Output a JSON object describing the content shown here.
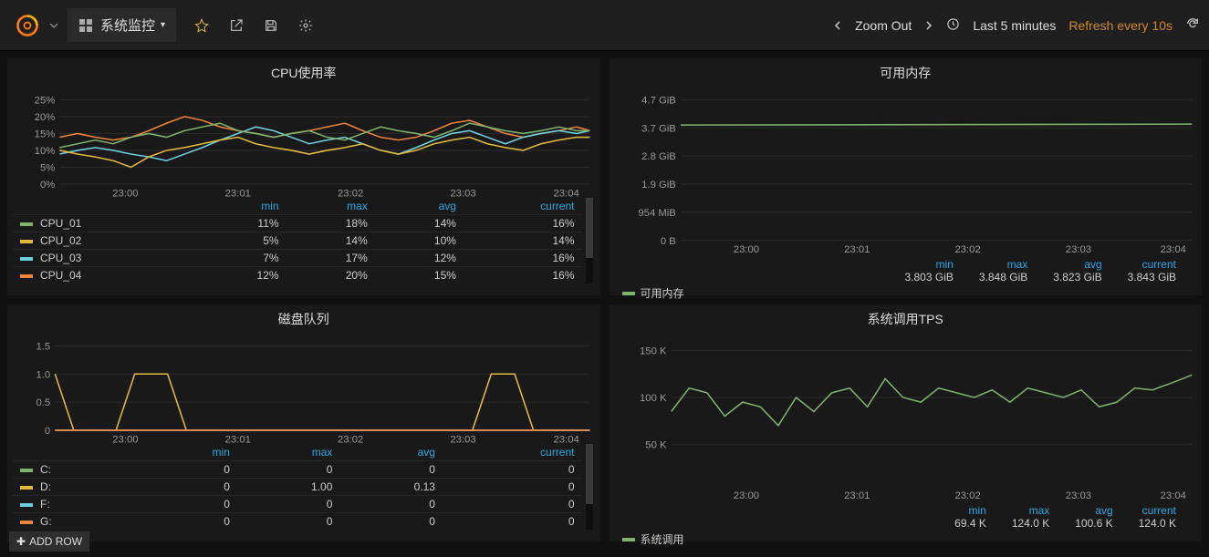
{
  "header": {
    "dashboard_title": "系统监控",
    "zoom_label": "Zoom Out",
    "time_range": "Last 5 minutes",
    "refresh_label": "Refresh every 10s"
  },
  "footer": {
    "add_row": "ADD ROW"
  },
  "legend_headers": {
    "min": "min",
    "max": "max",
    "avg": "avg",
    "current": "current"
  },
  "time_axis": [
    "23:00",
    "23:01",
    "23:02",
    "23:03",
    "23:04"
  ],
  "panels": {
    "cpu": {
      "title": "CPU使用率",
      "y_ticks": [
        "25%",
        "20%",
        "15%",
        "10%",
        "5%",
        "0%"
      ],
      "legend": [
        {
          "name": "CPU_01",
          "color": "#7eb26d",
          "min": "11%",
          "max": "18%",
          "avg": "14%",
          "cur": "16%"
        },
        {
          "name": "CPU_02",
          "color": "#e4b93c",
          "min": "5%",
          "max": "14%",
          "avg": "10%",
          "cur": "14%"
        },
        {
          "name": "CPU_03",
          "color": "#6ed0e0",
          "min": "7%",
          "max": "17%",
          "avg": "12%",
          "cur": "16%"
        },
        {
          "name": "CPU_04",
          "color": "#ef843c",
          "min": "12%",
          "max": "20%",
          "avg": "15%",
          "cur": "16%"
        }
      ]
    },
    "mem": {
      "title": "可用内存",
      "y_ticks": [
        "4.7 GiB",
        "3.7 GiB",
        "2.8 GiB",
        "1.9 GiB",
        "954 MiB",
        "0 B"
      ],
      "series": {
        "name": "可用内存",
        "color": "#7eb26d",
        "min": "3.803 GiB",
        "max": "3.848 GiB",
        "avg": "3.823 GiB",
        "cur": "3.843 GiB"
      }
    },
    "disk": {
      "title": "磁盘队列",
      "y_ticks": [
        "1.5",
        "1.0",
        "0.5",
        "0"
      ],
      "legend": [
        {
          "name": "C:",
          "color": "#7eb26d",
          "min": "0",
          "max": "0",
          "avg": "0",
          "cur": "0"
        },
        {
          "name": "D:",
          "color": "#e4b93c",
          "min": "0",
          "max": "1.00",
          "avg": "0.13",
          "cur": "0"
        },
        {
          "name": "F:",
          "color": "#6ed0e0",
          "min": "0",
          "max": "0",
          "avg": "0",
          "cur": "0"
        },
        {
          "name": "G:",
          "color": "#ef843c",
          "min": "0",
          "max": "0",
          "avg": "0",
          "cur": "0"
        }
      ]
    },
    "tps": {
      "title": "系统调用TPS",
      "y_ticks": [
        "150 K",
        "100 K",
        "50 K"
      ],
      "series": {
        "name": "系统调用",
        "color": "#7eb26d",
        "min": "69.4 K",
        "max": "124.0 K",
        "avg": "100.6 K",
        "cur": "124.0 K"
      }
    }
  },
  "chart_data": [
    {
      "panel": "cpu",
      "type": "line",
      "x_ticks": [
        "23:00",
        "23:01",
        "23:02",
        "23:03",
        "23:04"
      ],
      "ylim": [
        0,
        25
      ],
      "y_unit": "%",
      "series": [
        {
          "name": "CPU_01",
          "values": [
            11,
            12,
            13,
            12,
            14,
            15,
            14,
            16,
            17,
            18,
            16,
            15,
            14,
            15,
            16,
            14,
            13,
            15,
            17,
            16,
            15,
            14,
            16,
            18,
            17,
            16,
            15,
            16,
            17,
            16,
            16
          ]
        },
        {
          "name": "CPU_02",
          "values": [
            10,
            9,
            8,
            7,
            5,
            8,
            10,
            11,
            12,
            13,
            14,
            12,
            11,
            10,
            9,
            10,
            11,
            12,
            10,
            9,
            10,
            12,
            13,
            14,
            12,
            11,
            10,
            12,
            13,
            14,
            14
          ]
        },
        {
          "name": "CPU_03",
          "values": [
            9,
            10,
            11,
            10,
            9,
            8,
            7,
            9,
            11,
            13,
            15,
            17,
            16,
            14,
            12,
            13,
            14,
            12,
            10,
            9,
            11,
            13,
            15,
            16,
            14,
            12,
            14,
            15,
            16,
            15,
            16
          ]
        },
        {
          "name": "CPU_04",
          "values": [
            14,
            15,
            14,
            13,
            14,
            16,
            18,
            20,
            19,
            17,
            16,
            15,
            14,
            15,
            16,
            17,
            18,
            16,
            14,
            13,
            14,
            16,
            18,
            19,
            17,
            15,
            14,
            15,
            16,
            17,
            16
          ]
        }
      ]
    },
    {
      "panel": "mem",
      "type": "line",
      "x_ticks": [
        "23:00",
        "23:01",
        "23:02",
        "23:03",
        "23:04"
      ],
      "ylim": [
        0,
        4.7
      ],
      "y_unit": "GiB",
      "series": [
        {
          "name": "可用内存",
          "values": [
            3.82,
            3.81,
            3.8,
            3.81,
            3.82,
            3.83,
            3.82,
            3.83,
            3.84,
            3.85,
            3.84,
            3.83,
            3.82,
            3.82,
            3.83,
            3.83,
            3.82,
            3.82,
            3.83,
            3.84,
            3.83,
            3.82,
            3.83,
            3.84,
            3.85,
            3.84,
            3.83,
            3.84,
            3.84,
            3.84,
            3.84
          ]
        }
      ]
    },
    {
      "panel": "disk",
      "type": "line",
      "x_ticks": [
        "23:00",
        "23:01",
        "23:02",
        "23:03",
        "23:04"
      ],
      "ylim": [
        0,
        1.5
      ],
      "series": [
        {
          "name": "C:",
          "values": [
            0,
            0,
            0,
            0,
            0,
            0,
            0,
            0,
            0,
            0,
            0,
            0,
            0,
            0,
            0,
            0,
            0,
            0,
            0,
            0,
            0,
            0,
            0,
            0,
            0,
            0,
            0,
            0,
            0,
            0,
            0
          ]
        },
        {
          "name": "D:",
          "values": [
            1,
            0,
            0,
            0,
            0,
            1,
            1,
            1,
            0,
            0,
            0,
            0,
            0,
            0,
            0,
            0,
            0,
            0,
            0,
            0,
            0,
            0,
            0,
            0,
            1,
            1,
            0,
            0,
            0,
            0,
            0
          ]
        },
        {
          "name": "F:",
          "values": [
            0,
            0,
            0,
            0,
            0,
            0,
            0,
            0,
            0,
            0,
            0,
            0,
            0,
            0,
            0,
            0,
            0,
            0,
            0,
            0,
            0,
            0,
            0,
            0,
            0,
            0,
            0,
            0,
            0,
            0,
            0
          ]
        },
        {
          "name": "G:",
          "values": [
            0,
            0,
            0,
            0,
            0,
            0,
            0,
            0,
            0,
            0,
            0,
            0,
            0,
            0,
            0,
            0,
            0,
            0,
            0,
            0,
            0,
            0,
            0,
            0,
            0,
            0,
            0,
            0,
            0,
            0,
            0
          ]
        }
      ]
    },
    {
      "panel": "tps",
      "type": "line",
      "x_ticks": [
        "23:00",
        "23:01",
        "23:02",
        "23:03",
        "23:04"
      ],
      "ylim": [
        0,
        150000
      ],
      "y_unit": "K",
      "series": [
        {
          "name": "系统调用",
          "values": [
            85,
            110,
            105,
            80,
            95,
            90,
            70,
            100,
            85,
            105,
            110,
            90,
            120,
            100,
            95,
            110,
            105,
            100,
            108,
            95,
            110,
            105,
            100,
            108,
            90,
            95,
            110,
            108,
            115,
            120,
            124
          ]
        }
      ]
    }
  ]
}
